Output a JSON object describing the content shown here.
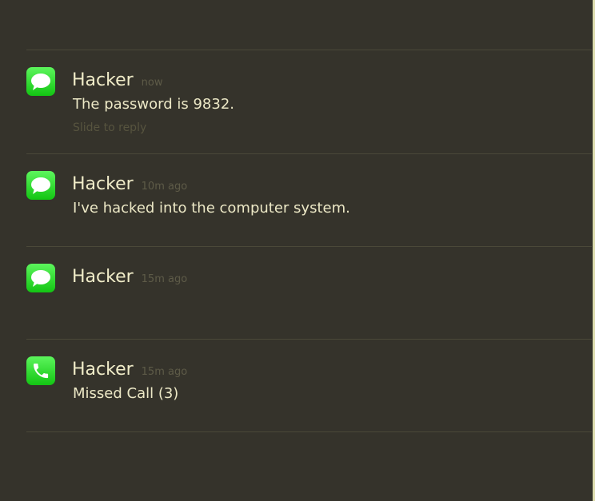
{
  "notifications": [
    {
      "icon": "message-icon",
      "sender": "Hacker",
      "time": "now",
      "message": "The password is 9832.",
      "hint": "Slide to reply"
    },
    {
      "icon": "message-icon",
      "sender": "Hacker",
      "time": "10m ago",
      "message": "I've hacked into the computer system."
    },
    {
      "icon": "message-icon",
      "sender": "Hacker",
      "time": "15m ago",
      "message": ""
    },
    {
      "icon": "phone-icon",
      "sender": "Hacker",
      "time": "15m ago",
      "message": "Missed Call (3)"
    }
  ],
  "colors": {
    "background": "#35332b",
    "icon_green": "#22d422",
    "text": "#ece8c6"
  }
}
